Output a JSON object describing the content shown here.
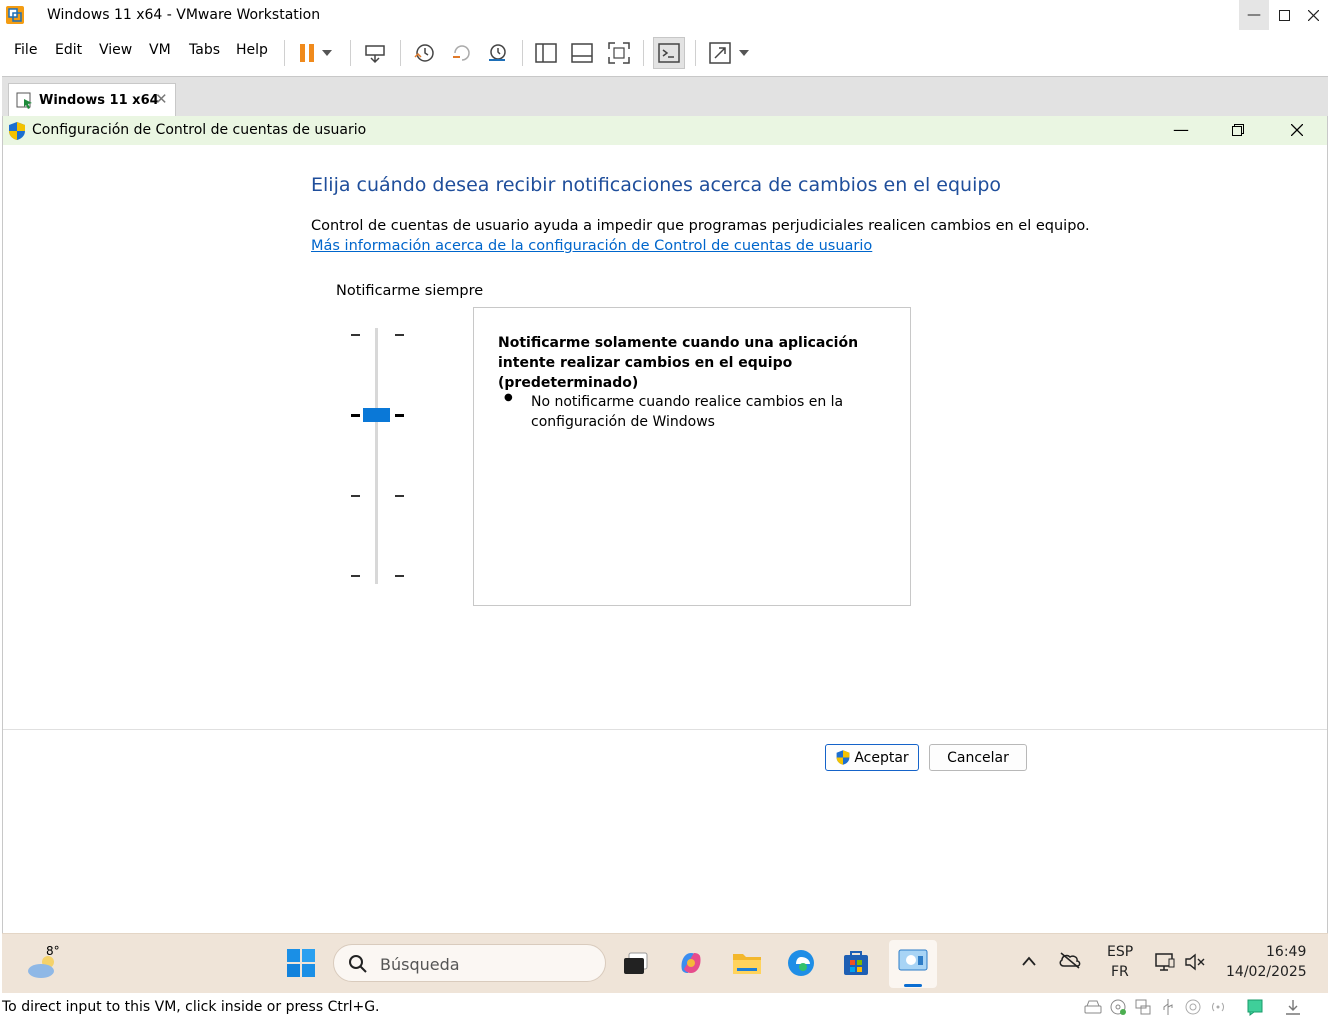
{
  "window": {
    "title": "Windows 11 x64 - VMware Workstation"
  },
  "menu": {
    "file": "File",
    "edit": "Edit",
    "view": "View",
    "vm": "VM",
    "tabs": "Tabs",
    "help": "Help"
  },
  "tab": {
    "label": "Windows 11 x64",
    "close": "✕"
  },
  "uac": {
    "title": "Configuración de Control de cuentas de usuario",
    "heading": "Elija cuándo desea recibir notificaciones acerca de cambios en el equipo",
    "description": "Control de cuentas de usuario ayuda a impedir que programas perjudiciales realicen cambios en el equipo.",
    "link": "Más información acerca de la configuración de Control de cuentas de usuario",
    "slider_top_label": "Notificarme siempre",
    "slider_level": 3,
    "slider_levels": 4,
    "info_title": "Notificarme solamente cuando una aplicación intente realizar cambios en el equipo (predeterminado)",
    "info_bullet": "No notificarme cuando realice cambios en la configuración de Windows",
    "ok_label": "Aceptar",
    "cancel_label": "Cancelar"
  },
  "taskbar": {
    "weather_temp": "8°",
    "search_placeholder": "Búsqueda",
    "lang_top": "ESP",
    "lang_bottom": "FR",
    "time": "16:49",
    "date": "14/02/2025"
  },
  "status": {
    "message": "To direct input to this VM, click inside or press Ctrl+G."
  },
  "colors": {
    "accent": "#0a78d7",
    "uac_title_bg": "#eaf6e2",
    "heading": "#1f4e9b",
    "link": "#0066cc",
    "taskbar_bg": "#efe4d8"
  }
}
